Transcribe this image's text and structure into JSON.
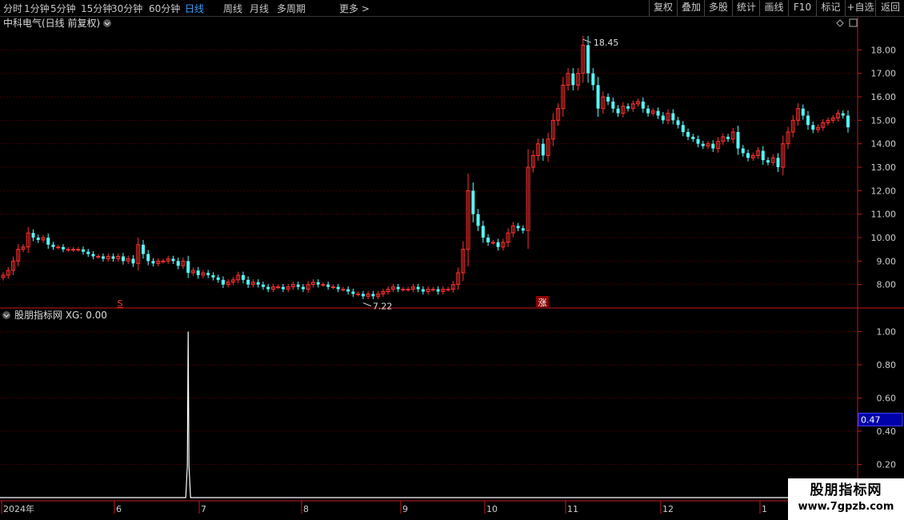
{
  "toolbar": {
    "left_items": [
      "分时",
      "1分钟",
      "5分钟",
      "15分钟",
      "30分钟",
      "60分钟",
      "日线",
      "周线",
      "月线",
      "多周期",
      "更多 >"
    ],
    "active": "日线",
    "right_items": [
      "复权",
      "叠加",
      "多股",
      "统计",
      "画线",
      "F10",
      "标记",
      "+自选",
      "返回"
    ]
  },
  "main_panel": {
    "stock_title": "中科电气(日线 前复权)",
    "high_label": "18.45",
    "low_label": "7.22",
    "marker_s": "S",
    "marker_zhang": "涨"
  },
  "indicator_panel": {
    "title": "股朋指标网 XG: 0.00",
    "current_value": "0.47"
  },
  "watermark": {
    "title": "股朋指标网",
    "url": "www.7gpzb.com"
  },
  "colors": {
    "up": "#ff3232",
    "down": "#54ffff",
    "grid": "#8b0000",
    "axis": "#c41a1a"
  },
  "chart_data": [
    {
      "type": "candlestick",
      "title": "中科电气(日线 前复权)",
      "ylim": [
        7.0,
        18.9
      ],
      "yticks": [
        8.0,
        9.0,
        10.0,
        11.0,
        12.0,
        13.0,
        14.0,
        15.0,
        16.0,
        17.0,
        18.0
      ],
      "ytick_labels": [
        "8.00",
        "9.00",
        "10.00",
        "11.00",
        "12.00",
        "13.00",
        "14.00",
        "15.00",
        "16.00",
        "17.00",
        "18.00"
      ],
      "xtick_labels": [
        "2024年",
        "6",
        "7",
        "8",
        "9",
        "10",
        "11",
        "12",
        "1"
      ],
      "high": 18.45,
      "low": 7.22,
      "closes": [
        8.4,
        8.6,
        9.0,
        9.5,
        9.6,
        10.2,
        10.0,
        9.9,
        10.0,
        9.7,
        9.6,
        9.6,
        9.5,
        9.5,
        9.5,
        9.5,
        9.4,
        9.3,
        9.2,
        9.2,
        9.1,
        9.2,
        9.1,
        9.2,
        9.0,
        9.1,
        8.9,
        9.7,
        9.3,
        9.0,
        8.9,
        9.0,
        9.0,
        9.1,
        9.0,
        8.8,
        9.0,
        8.5,
        8.6,
        8.4,
        8.5,
        8.4,
        8.3,
        8.2,
        8.0,
        8.1,
        8.2,
        8.4,
        8.2,
        8.0,
        8.1,
        8.0,
        7.9,
        7.8,
        7.9,
        7.9,
        7.8,
        7.9,
        8.0,
        7.9,
        7.8,
        8.0,
        8.1,
        8.0,
        8.0,
        7.9,
        7.9,
        7.8,
        7.8,
        7.7,
        7.6,
        7.6,
        7.5,
        7.6,
        7.5,
        7.6,
        7.7,
        7.8,
        7.9,
        7.8,
        7.8,
        7.8,
        7.9,
        7.8,
        7.7,
        7.8,
        7.8,
        7.7,
        7.8,
        7.8,
        8.0,
        8.5,
        9.5,
        12.0,
        11.0,
        10.5,
        10.0,
        9.8,
        9.8,
        9.6,
        9.8,
        10.2,
        10.5,
        10.4,
        10.3,
        13.0,
        13.5,
        14.0,
        13.5,
        14.2,
        15.0,
        15.5,
        16.5,
        17.0,
        16.5,
        17.0,
        18.2,
        17.0,
        16.5,
        15.5,
        16.0,
        15.8,
        15.5,
        15.3,
        15.6,
        15.5,
        15.7,
        15.8,
        15.5,
        15.3,
        15.4,
        15.2,
        15.0,
        15.3,
        15.0,
        14.8,
        14.5,
        14.3,
        14.2,
        14.0,
        13.9,
        14.0,
        13.8,
        14.1,
        14.3,
        14.2,
        14.5,
        13.8,
        13.6,
        13.4,
        13.5,
        13.7,
        13.3,
        13.2,
        13.4,
        13.0,
        14.0,
        14.5,
        15.0,
        15.5,
        15.2,
        14.8,
        14.6,
        14.7,
        14.9,
        15.0,
        15.1,
        15.3,
        15.2,
        14.7
      ]
    },
    {
      "type": "line",
      "name": "XG",
      "ylim": [
        0.0,
        1.06
      ],
      "yticks": [
        0.2,
        0.4,
        0.6,
        0.8,
        1.0
      ],
      "ytick_labels": [
        "0.20",
        "0.40",
        "0.60",
        "0.80",
        "1.00"
      ],
      "spike_index": 37,
      "spike_value": 1.0,
      "baseline": 0.0,
      "current_value": 0.47
    }
  ]
}
